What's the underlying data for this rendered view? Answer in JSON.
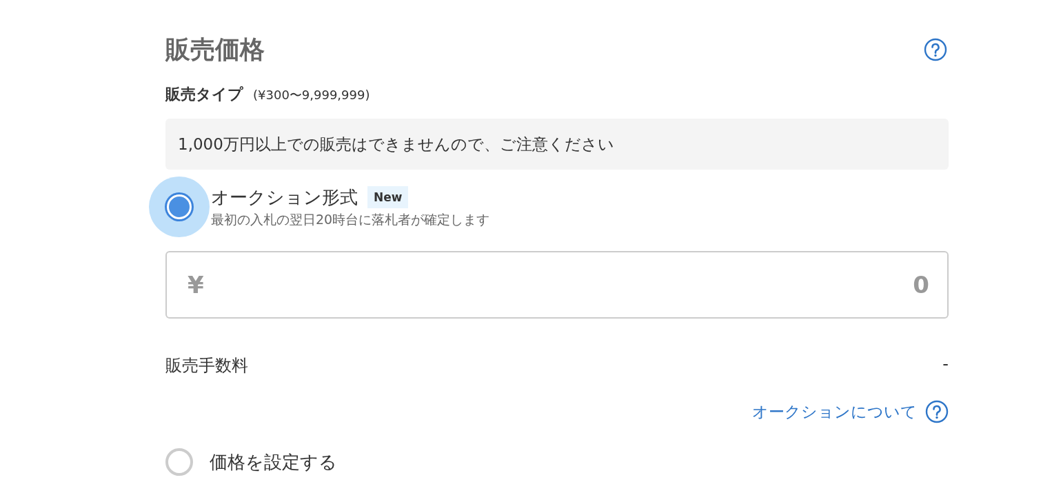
{
  "section": {
    "title": "販売価格",
    "sale_type": {
      "label": "販売タイプ",
      "range": "(¥300〜9,999,999)"
    },
    "notice": "1,000万円以上での販売はできませんので、ご注意ください"
  },
  "options": [
    {
      "label": "オークション形式",
      "selected": true,
      "badge": "New",
      "description": "最初の入札の翌日20時台に落札者が確定します",
      "price": {
        "currency": "¥",
        "placeholder": "0"
      },
      "fee": {
        "label": "販売手数料",
        "value": "-"
      },
      "link": "オークションについて"
    },
    {
      "label": "価格を設定する",
      "selected": false
    }
  ]
}
